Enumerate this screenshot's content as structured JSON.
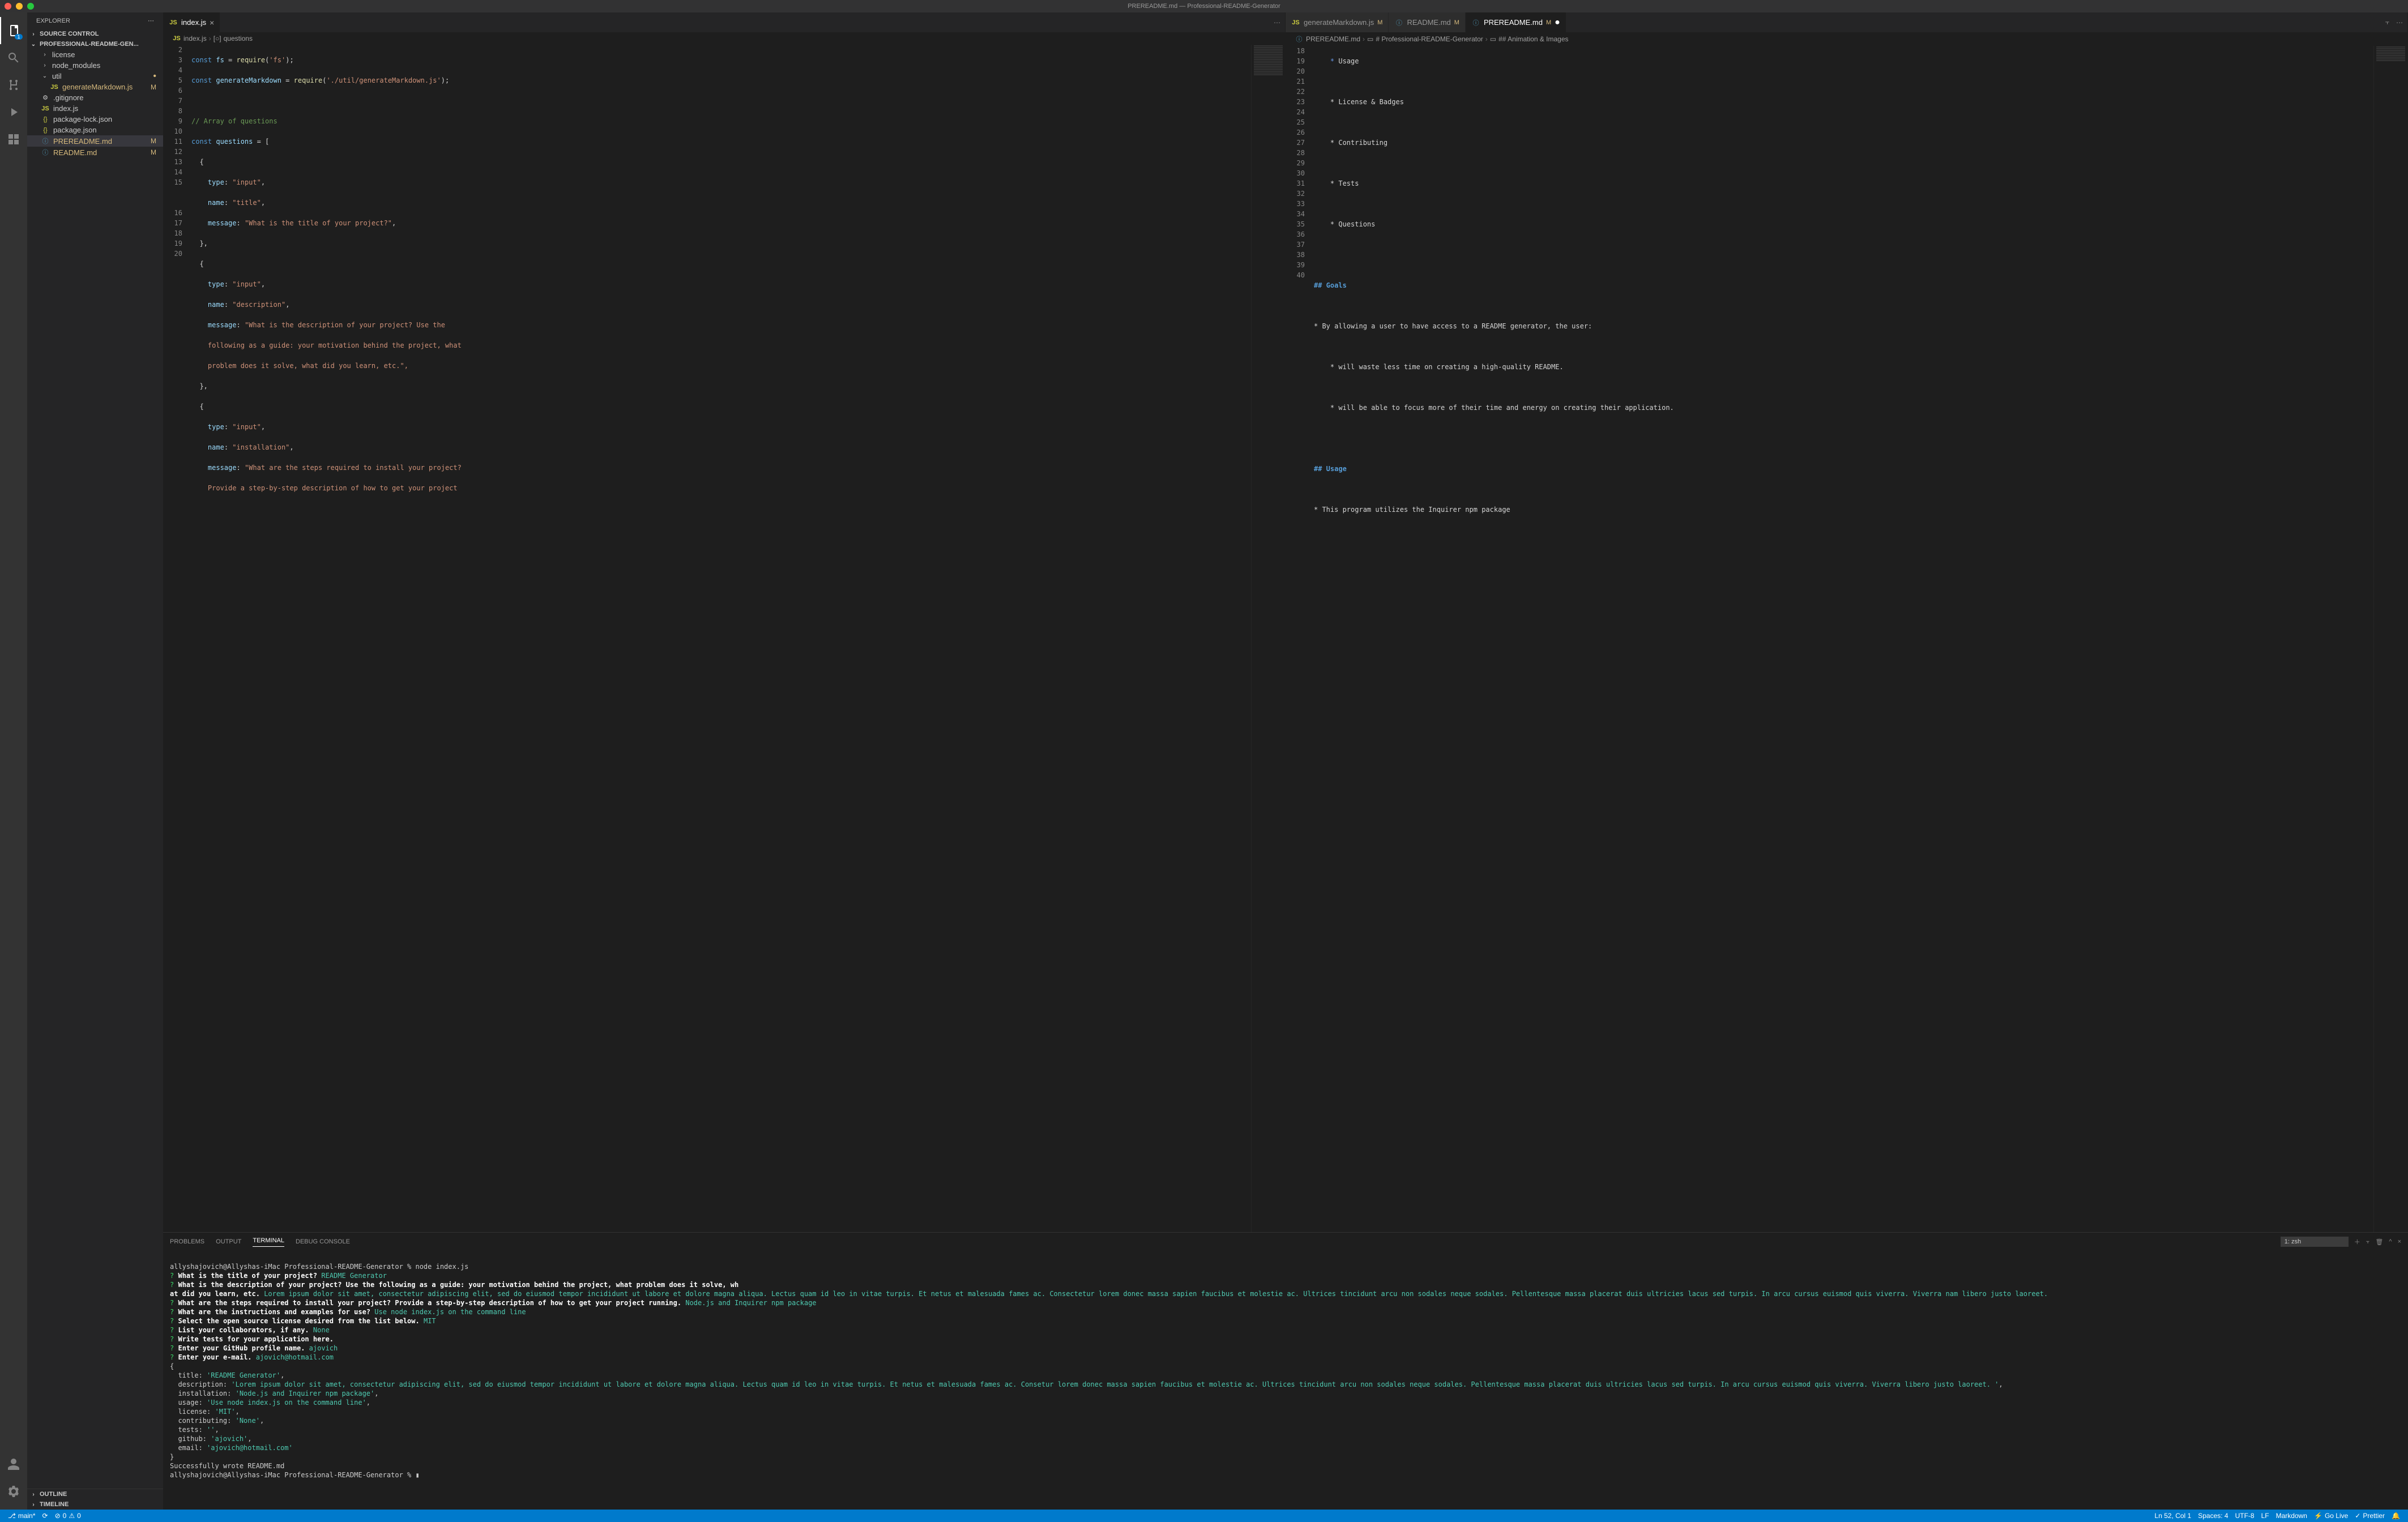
{
  "window": {
    "title": "PREREADME.md — Professional-README-Generator"
  },
  "activity": {
    "explorer_badge": "1"
  },
  "explorer": {
    "title": "EXPLORER",
    "sections": {
      "source_control": "SOURCE CONTROL",
      "project": "PROFESSIONAL-README-GEN...",
      "outline": "OUTLINE",
      "timeline": "TIMELINE"
    },
    "tree": {
      "license": "license",
      "node_modules": "node_modules",
      "util": "util",
      "generateMarkdown": "generateMarkdown.js",
      "generateMarkdown_status": "M",
      "gitignore": ".gitignore",
      "index": "index.js",
      "package_lock": "package-lock.json",
      "package": "package.json",
      "prereadme": "PREREADME.md",
      "prereadme_status": "M",
      "readme": "README.md",
      "readme_status": "M"
    }
  },
  "editor_left": {
    "tab1": "index.js",
    "breadcrumb": {
      "file": "index.js",
      "sym1": "questions"
    },
    "lines": {
      "l2": [
        "const ",
        "fs",
        " = ",
        "require",
        "(",
        "'fs'",
        ");"
      ],
      "l3": [
        "const ",
        "generateMarkdown",
        " = ",
        "require",
        "(",
        "'./util/generateMarkdown.js'",
        ");"
      ],
      "l5": "// Array of questions",
      "l6": [
        "const ",
        "questions",
        " = ["
      ],
      "l7": "{",
      "l8": [
        "type",
        ": ",
        "\"input\"",
        ","
      ],
      "l9": [
        "name",
        ": ",
        "\"title\"",
        ","
      ],
      "l10": [
        "message",
        ": ",
        "\"What is the title of your project?\"",
        ","
      ],
      "l11": "},",
      "l12": "{",
      "l13": [
        "type",
        ": ",
        "\"input\"",
        ","
      ],
      "l14": [
        "name",
        ": ",
        "\"description\"",
        ","
      ],
      "l15a": [
        "message",
        ": ",
        "\"What is the description of your project? Use the "
      ],
      "l15b": "following as a guide: your motivation behind the project, what ",
      "l15c": "problem does it solve, what did you learn, etc.\",",
      "l16": "},",
      "l17": "{",
      "l18": [
        "type",
        ": ",
        "\"input\"",
        ","
      ],
      "l19": [
        "name",
        ": ",
        "\"installation\"",
        ","
      ],
      "l20a": [
        "message",
        ": ",
        "\"What are the steps required to install your project? "
      ],
      "l20b": "Provide a step-by-step description of how to get your project "
    },
    "line_numbers": [
      "2",
      "3",
      "4",
      "5",
      "6",
      "7",
      "8",
      "9",
      "10",
      "11",
      "12",
      "13",
      "14",
      "15",
      "",
      "",
      "16",
      "17",
      "18",
      "19",
      "20",
      "",
      ""
    ]
  },
  "editor_right_tabs": {
    "tab1": "generateMarkdown.js",
    "tab1_mod": "M",
    "tab2": "README.md",
    "tab2_mod": "M",
    "tab3": "PREREADME.md",
    "tab3_mod": "M"
  },
  "editor_right": {
    "breadcrumb": {
      "file": "PREREADME.md",
      "s1": "# Professional-README-Generator",
      "s2": "## Animation & Images"
    },
    "line_numbers": [
      "18",
      "19",
      "20",
      "21",
      "22",
      "23",
      "24",
      "25",
      "26",
      "27",
      "28",
      "29",
      "30",
      "31",
      "32",
      "33",
      "34",
      "35",
      "36",
      "37",
      "38",
      "39",
      "40"
    ],
    "lines": {
      "usage_top": "* Usage",
      "l20": "* License & Badges",
      "l22": "* Contributing",
      "l24": "* Tests",
      "l26": "* Questions",
      "l29": "## Goals",
      "l31": "* By allowing a user to have access to a README generator, the user:",
      "l33": "* will waste less time on creating a high-quality README.",
      "l35": "* will be able to focus more of their time and energy on creating their application.",
      "l38": "## Usage",
      "l40": "* This program utilizes the Inquirer npm package"
    }
  },
  "panel": {
    "tabs": {
      "problems": "PROBLEMS",
      "output": "OUTPUT",
      "terminal": "TERMINAL",
      "debug": "DEBUG CONSOLE"
    },
    "shell": "1: zsh"
  },
  "terminal": {
    "line1": "allyshajovich@Allyshas-iMac Professional-README-Generator % node index.js",
    "q1": "What is the title of your project?",
    "a1": "README Generator",
    "q2": "What is the description of your project? Use the following as a guide: your motivation behind the project, what problem does it solve, wh",
    "q2b": "at did you learn, etc.",
    "a2": "Lorem ipsum dolor sit amet, consectetur adipiscing elit, sed do eiusmod tempor incididunt ut labore et dolore magna aliqua. Lectus quam id leo in vitae turpis. Et netus et malesuada fames ac. Consectetur lorem donec massa sapien faucibus et molestie ac. Ultrices tincidunt arcu non sodales neque sodales. Pellentesque massa placerat duis ultricies lacus sed turpis. In arcu cursus euismod quis viverra. Viverra nam libero justo laoreet.",
    "q3": "What are the steps required to install your project? Provide a step-by-step description of how to get your project running.",
    "a3": "Node.js and Inquirer npm package",
    "q4": "What are the instructions and examples for use?",
    "a4": "Use node index.js on the command line",
    "q5": "Select the open source license desired from the list below.",
    "a5": "MIT",
    "q6": "List your collaborators, if any.",
    "a6": "None",
    "q7": "Write tests for your application here.",
    "q8": "Enter your GitHub profile name.",
    "a8": "ajovich",
    "q9": "Enter your e-mail.",
    "a9": "ajovich@hotmail.com",
    "obj_open": "{",
    "obj_title": "  title: ",
    "obj_title_v": "'README Generator'",
    "obj_desc": "  description: ",
    "obj_desc_v": "'Lorem ipsum dolor sit amet, consectetur adipiscing elit, sed do eiusmod tempor incididunt ut labore et dolore magna aliqua. Lectus quam id leo in vitae turpis. Et netus et malesuada fames ac. Consetur lorem donec massa sapien faucibus et molestie ac. Ultrices tincidunt arcu non sodales neque sodales. Pellentesque massa placerat duis ultricies lacus sed turpis. In arcu cursus euismod quis viverra. Viverra libero justo laoreet. '",
    "obj_install": "  installation: ",
    "obj_install_v": "'Node.js and Inquirer npm package'",
    "obj_usage": "  usage: ",
    "obj_usage_v": "'Use node index.js on the command line'",
    "obj_license": "  license: ",
    "obj_license_v": "'MIT'",
    "obj_contrib": "  contributing: ",
    "obj_contrib_v": "'None'",
    "obj_tests": "  tests: ",
    "obj_tests_v": "''",
    "obj_github": "  github: ",
    "obj_github_v": "'ajovich'",
    "obj_email": "  email: ",
    "obj_email_v": "'ajovich@hotmail.com'",
    "obj_close": "}",
    "success": "Successfully wrote README.md",
    "prompt2": "allyshajovich@Allyshas-iMac Professional-README-Generator % "
  },
  "statusbar": {
    "branch": "main*",
    "sync": "⟳",
    "errors": "0",
    "warnings": "0",
    "ln_col": "Ln 52, Col 1",
    "spaces": "Spaces: 4",
    "encoding": "UTF-8",
    "eol": "LF",
    "lang": "Markdown",
    "golive": "Go Live",
    "prettier": "Prettier",
    "bell": ""
  }
}
